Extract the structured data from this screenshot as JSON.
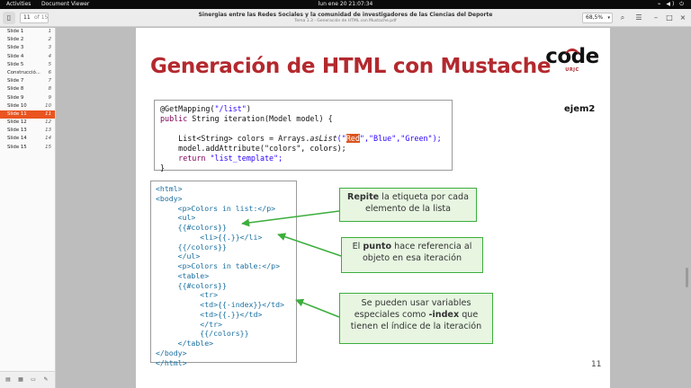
{
  "topbar": {
    "activities": "Activities",
    "app": "Document Viewer",
    "clock": "lun ene 20  21:07:34",
    "tray": "⌁ ◀) ⏻"
  },
  "header": {
    "page_value": "11",
    "page_of": "of 15",
    "title": "Sinergias entre las Redes Sociales y la comunidad de investigadores de las Ciencias del Deporte",
    "subtitle": "Tema 1.3 - Generación de HTML con Mustache.pdf",
    "zoom": "68,5%",
    "icons": {
      "sidebar_toggle": "▯",
      "search": "⌕",
      "menu": "☰",
      "minimize": "–",
      "maximize": "□",
      "close": "×",
      "zoom_caret": "▾"
    }
  },
  "sidebar": {
    "items": [
      {
        "label": "Slide 1",
        "num": "1"
      },
      {
        "label": "Slide 2",
        "num": "2"
      },
      {
        "label": "Slide 3",
        "num": "3"
      },
      {
        "label": "Slide 4",
        "num": "4"
      },
      {
        "label": "Slide 5",
        "num": "5"
      },
      {
        "label": "Construcció...",
        "num": "6"
      },
      {
        "label": "Slide 7",
        "num": "7"
      },
      {
        "label": "Slide 8",
        "num": "8"
      },
      {
        "label": "Slide 9",
        "num": "9"
      },
      {
        "label": "Slide 10",
        "num": "10"
      },
      {
        "label": "Slide 11",
        "num": "11"
      },
      {
        "label": "Slide 12",
        "num": "12"
      },
      {
        "label": "Slide 13",
        "num": "13"
      },
      {
        "label": "Slide 14",
        "num": "14"
      },
      {
        "label": "Slide 15",
        "num": "15"
      }
    ],
    "active_index": 10,
    "bottom_icons": [
      "▤",
      "▦",
      "▭",
      "✎"
    ]
  },
  "slide": {
    "title": "Generación de HTML con Mustache",
    "logo_word": "code",
    "logo_sub": "URJC",
    "ejem": "ejem2",
    "page_number": "11",
    "java": {
      "l1a": "@GetMapping(",
      "l1b": "\"/list\"",
      "l1c": ")",
      "l2a": "public",
      "l2b": " String iteration(Model model) {",
      "l4a": "    List<String> colors = Arrays.",
      "l4b": "asList",
      "l4c": "(\"",
      "l4d": "Red",
      "l4e": "\",\"Blue\",\"Green\");",
      "l5": "    model.addAttribute(\"colors\", colors);",
      "l6a": "    ",
      "l6b": "return",
      "l6c": " \"list_template\";",
      "l7": "}"
    },
    "html_lines": [
      "<html>",
      "<body>",
      "     <p>Colors in list:</p>",
      "     <ul>",
      "     {{#colors}}",
      "          <li>{{.}}</li>",
      "     {{/colors}}",
      "     </ul>",
      "     <p>Colors in table:</p>",
      "     <table>",
      "     {{#colors}}",
      "          <tr>",
      "          <td>{{-index}}</td>",
      "          <td>{{.}}</td>",
      "          </tr>",
      "          {{/colors}}",
      "     </table>",
      "</body>",
      "</html>"
    ],
    "callouts": {
      "c1a": "Repite",
      "c1b": " la etiqueta por cada elemento de la lista",
      "c2a": "El ",
      "c2b": "punto",
      "c2c": " hace referencia al objeto en esa iteración",
      "c3a": "Se pueden usar variables especiales como ",
      "c3b": "-index",
      "c3c": " que tienen el índice de la iteración"
    },
    "callout_color": "#3cae3c",
    "title_color": "#b3292e"
  }
}
